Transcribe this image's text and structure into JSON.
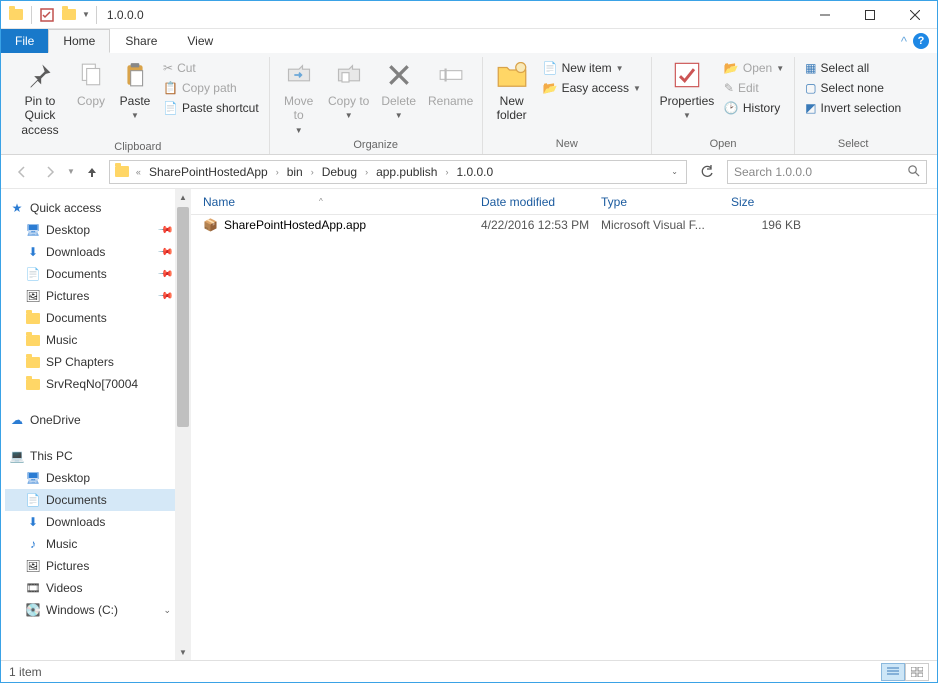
{
  "window": {
    "title": "1.0.0.0"
  },
  "tabs": {
    "file": "File",
    "home": "Home",
    "share": "Share",
    "view": "View"
  },
  "ribbon": {
    "clipboard": {
      "label": "Clipboard",
      "pin": "Pin to Quick access",
      "copy": "Copy",
      "paste": "Paste",
      "cut": "Cut",
      "copy_path": "Copy path",
      "paste_shortcut": "Paste shortcut"
    },
    "organize": {
      "label": "Organize",
      "move_to": "Move to",
      "copy_to": "Copy to",
      "delete": "Delete",
      "rename": "Rename"
    },
    "new": {
      "label": "New",
      "new_folder": "New folder",
      "new_item": "New item",
      "easy_access": "Easy access"
    },
    "open": {
      "label": "Open",
      "properties": "Properties",
      "open": "Open",
      "edit": "Edit",
      "history": "History"
    },
    "select": {
      "label": "Select",
      "select_all": "Select all",
      "select_none": "Select none",
      "invert": "Invert selection"
    }
  },
  "breadcrumb": {
    "parts": [
      "SharePointHostedApp",
      "bin",
      "Debug",
      "app.publish",
      "1.0.0.0"
    ]
  },
  "search": {
    "placeholder": "Search 1.0.0.0"
  },
  "nav": {
    "quick_access": {
      "label": "Quick access",
      "items": [
        {
          "label": "Desktop",
          "pinned": true
        },
        {
          "label": "Downloads",
          "pinned": true
        },
        {
          "label": "Documents",
          "pinned": true
        },
        {
          "label": "Pictures",
          "pinned": true
        },
        {
          "label": "Documents",
          "pinned": false
        },
        {
          "label": "Music",
          "pinned": false
        },
        {
          "label": "SP Chapters",
          "pinned": false
        },
        {
          "label": "SrvReqNo[70004",
          "pinned": false
        }
      ]
    },
    "onedrive": {
      "label": "OneDrive"
    },
    "this_pc": {
      "label": "This PC",
      "items": [
        {
          "label": "Desktop"
        },
        {
          "label": "Documents",
          "selected": true
        },
        {
          "label": "Downloads"
        },
        {
          "label": "Music"
        },
        {
          "label": "Pictures"
        },
        {
          "label": "Videos"
        },
        {
          "label": "Windows (C:)"
        }
      ]
    }
  },
  "columns": {
    "name": "Name",
    "date": "Date modified",
    "type": "Type",
    "size": "Size"
  },
  "files": [
    {
      "name": "SharePointHostedApp.app",
      "date": "4/22/2016 12:53 PM",
      "type": "Microsoft Visual F...",
      "size": "196 KB"
    }
  ],
  "status": {
    "count": "1 item"
  }
}
